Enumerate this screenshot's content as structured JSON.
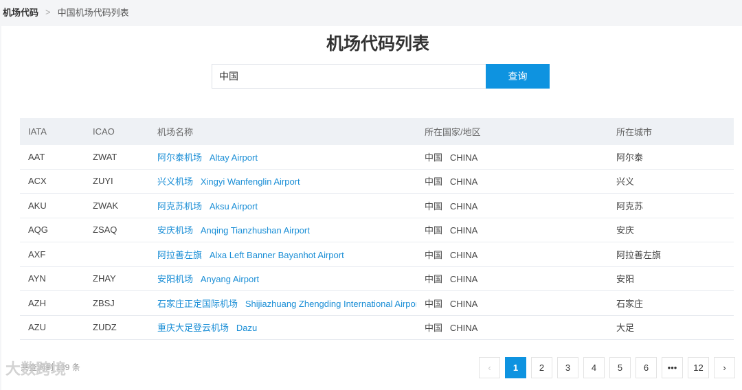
{
  "breadcrumb": {
    "root": "机场代码",
    "current": "中国机场代码列表"
  },
  "title": "机场代码列表",
  "search": {
    "value": "中国",
    "button": "查询"
  },
  "columns": [
    "IATA",
    "ICAO",
    "机场名称",
    "所在国家/地区",
    "所在城市"
  ],
  "rows": [
    {
      "iata": "AAT",
      "icao": "ZWAT",
      "cn": "阿尔泰机场",
      "en": "Altay Airport",
      "country_cn": "中国",
      "country_en": "CHINA",
      "city": "阿尔泰"
    },
    {
      "iata": "ACX",
      "icao": "ZUYI",
      "cn": "兴义机场",
      "en": "Xingyi Wanfenglin Airport",
      "country_cn": "中国",
      "country_en": "CHINA",
      "city": "兴义"
    },
    {
      "iata": "AKU",
      "icao": "ZWAK",
      "cn": "阿克苏机场",
      "en": "Aksu Airport",
      "country_cn": "中国",
      "country_en": "CHINA",
      "city": "阿克苏"
    },
    {
      "iata": "AQG",
      "icao": "ZSAQ",
      "cn": "安庆机场",
      "en": "Anqing Tianzhushan Airport",
      "country_cn": "中国",
      "country_en": "CHINA",
      "city": "安庆"
    },
    {
      "iata": "AXF",
      "icao": "",
      "cn": "阿拉善左旗",
      "en": "Alxa Left Banner Bayanhot Airport",
      "country_cn": "中国",
      "country_en": "CHINA",
      "city": "阿拉善左旗"
    },
    {
      "iata": "AYN",
      "icao": "ZHAY",
      "cn": "安阳机场",
      "en": "Anyang Airport",
      "country_cn": "中国",
      "country_en": "CHINA",
      "city": "安阳"
    },
    {
      "iata": "AZH",
      "icao": "ZBSJ",
      "cn": "石家庄正定国际机场",
      "en": "Shijiazhuang Zhengding International Airport",
      "country_cn": "中国",
      "country_en": "CHINA",
      "city": "石家庄"
    },
    {
      "iata": "AZU",
      "icao": "ZUDZ",
      "cn": "重庆大足登云机场",
      "en": "Dazu",
      "country_cn": "中国",
      "country_en": "CHINA",
      "city": "大足"
    }
  ],
  "footer": {
    "total": "共查询到 139 条"
  },
  "pagination": {
    "prev": "‹",
    "pages": [
      "1",
      "2",
      "3",
      "4",
      "5",
      "6",
      "•••",
      "12"
    ],
    "current": "1",
    "next": "›"
  },
  "watermark": "大数跨境"
}
